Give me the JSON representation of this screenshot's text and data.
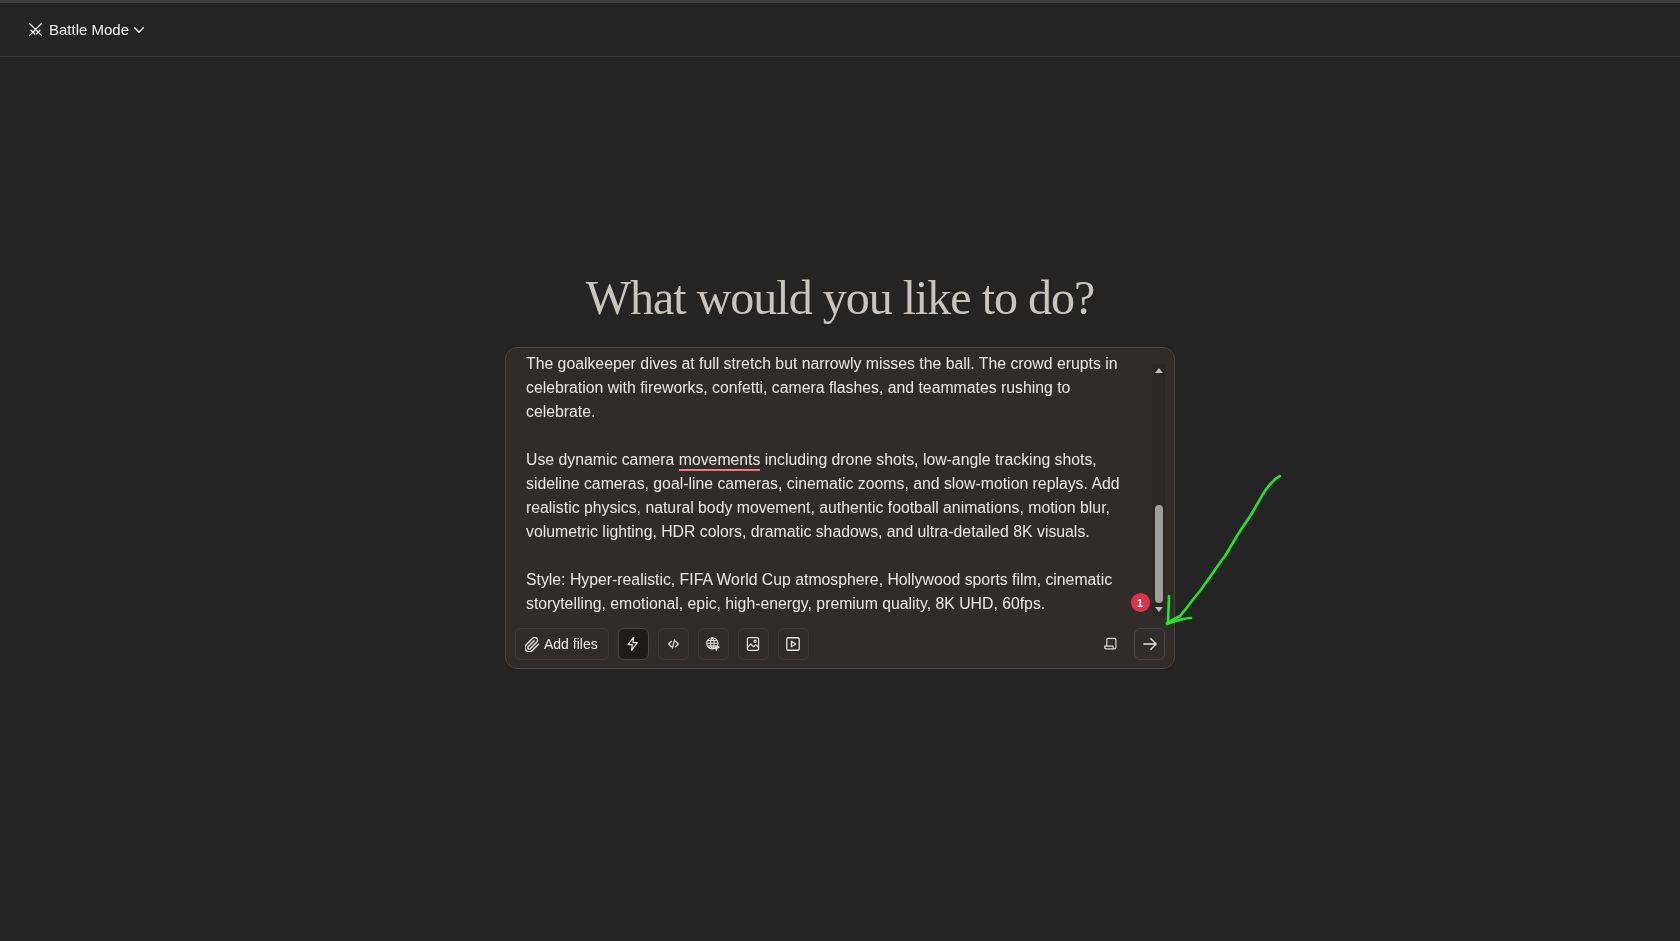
{
  "header": {
    "mode_label": "Battle Mode"
  },
  "heading": "What would you like to do?",
  "prompt": {
    "paragraphs": [
      {
        "segments": [
          {
            "text": "The goalkeeper dives at full stretch but narrowly misses the ball. The crowd erupts in celebration with fireworks, confetti, camera flashes, and teammates rushing to celebrate.",
            "flagged": false
          }
        ]
      },
      {
        "segments": [
          {
            "text": "Use dynamic camera ",
            "flagged": false
          },
          {
            "text": "movements",
            "flagged": true
          },
          {
            "text": " including drone shots, low-angle tracking shots, sideline cameras, goal-line cameras, cinematic zooms, and slow-motion replays. Add realistic physics, natural body movement, authentic football animations, motion blur, volumetric lighting, HDR colors, dramatic shadows, and ultra-detailed 8K visuals.",
            "flagged": false
          }
        ]
      },
      {
        "segments": [
          {
            "text": "Style: Hyper-realistic, FIFA World Cup atmosphere, Hollywood sports film, cinematic storytelling, emotional, epic, high-energy, premium quality, 8K UHD, 60fps.",
            "flagged": false
          }
        ]
      }
    ],
    "issue_count": "1"
  },
  "toolbar": {
    "add_files_label": "Add files",
    "tools": [
      {
        "kind": "flash",
        "selected": true
      },
      {
        "kind": "code",
        "selected": false
      },
      {
        "kind": "web",
        "selected": false
      },
      {
        "kind": "image",
        "selected": false
      },
      {
        "kind": "video",
        "selected": false
      }
    ]
  }
}
